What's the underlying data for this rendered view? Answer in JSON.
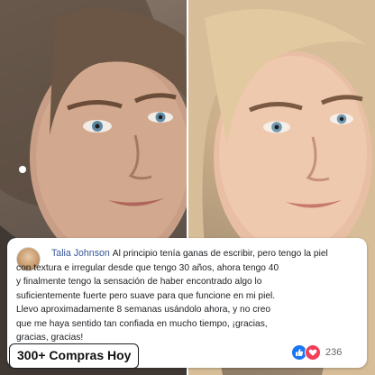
{
  "review": {
    "author": "Talia Johnson",
    "lines": [
      "Al principio tenía ganas de escribir, pero tengo la piel",
      "con textura e irregular desde que tengo 30 años, ahora tengo 40",
      "y finalmente tengo la sensación de haber encontrado algo lo",
      "suficientemente fuerte pero suave para que funcione en mi piel.",
      "Llevo aproximadamente 8 semanas usándolo ahora, y no creo",
      "que me haya sentido tan confiada en mucho tiempo, ¡gracias,",
      "gracias, gracias!"
    ]
  },
  "cta": {
    "label": "300+ Compras Hoy"
  },
  "reactions": {
    "count": "236",
    "icons": [
      "like-icon",
      "love-icon"
    ]
  },
  "colors": {
    "author": "#385898",
    "like": "#1877f2",
    "love": "#f33e58"
  }
}
